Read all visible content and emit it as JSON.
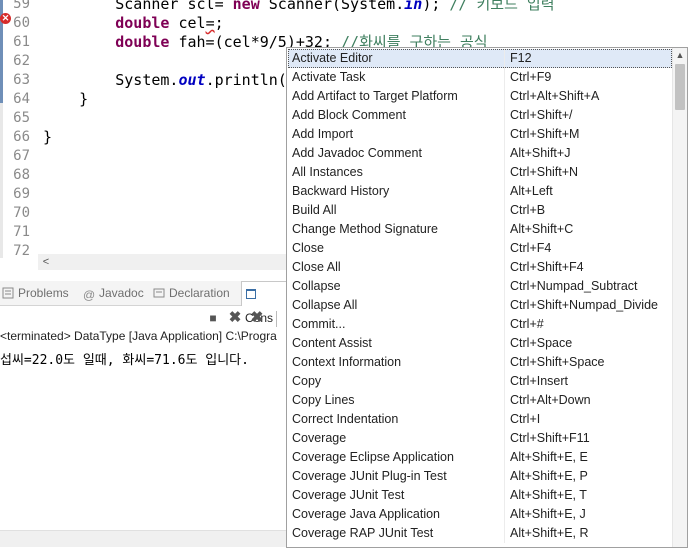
{
  "editor": {
    "line_numbers": [
      "59",
      "60",
      "61",
      "62",
      "63",
      "64",
      "65",
      "66",
      "67",
      "68",
      "69",
      "70",
      "71",
      "72"
    ],
    "lines": [
      {
        "indent": "        ",
        "parts": [
          {
            "t": "Scanner scl= ",
            "c": ""
          },
          {
            "t": "new",
            "c": "kw"
          },
          {
            "t": " Scanner(System.",
            "c": ""
          },
          {
            "t": "in",
            "c": "fld"
          },
          {
            "t": "); ",
            "c": ""
          },
          {
            "t": "// 키보드 입력",
            "c": "cmt"
          }
        ]
      },
      {
        "indent": "        ",
        "parts": [
          {
            "t": "double",
            "c": "kw"
          },
          {
            "t": " cel",
            "c": ""
          },
          {
            "t": "=",
            "c": "squiggle"
          },
          {
            "t": ";",
            "c": ""
          }
        ]
      },
      {
        "indent": "        ",
        "parts": [
          {
            "t": "double",
            "c": "kw"
          },
          {
            "t": " fah=(cel*9/5)+32; ",
            "c": ""
          },
          {
            "t": "//화씨를 구하는 공식",
            "c": "cmt"
          }
        ]
      },
      {
        "indent": "",
        "parts": []
      },
      {
        "indent": "        ",
        "parts": [
          {
            "t": "System.",
            "c": ""
          },
          {
            "t": "out",
            "c": "fld"
          },
          {
            "t": ".println(",
            "c": ""
          }
        ]
      },
      {
        "indent": "    ",
        "parts": [
          {
            "t": "}",
            "c": ""
          }
        ]
      },
      {
        "indent": "",
        "parts": []
      },
      {
        "indent": "",
        "parts": [
          {
            "t": "}",
            "c": ""
          }
        ]
      },
      {
        "indent": "",
        "parts": []
      },
      {
        "indent": "",
        "parts": []
      },
      {
        "indent": "",
        "parts": []
      },
      {
        "indent": "",
        "parts": []
      },
      {
        "indent": "",
        "parts": []
      },
      {
        "indent": "",
        "parts": []
      }
    ],
    "error_line": "60"
  },
  "views": {
    "tabs": [
      {
        "label": "Problems",
        "icon": "problems-icon"
      },
      {
        "label": "Javadoc",
        "icon": "at-icon"
      },
      {
        "label": "Declaration",
        "icon": "declaration-icon"
      },
      {
        "label": "Cons",
        "icon": "console-icon",
        "active": true
      }
    ]
  },
  "console": {
    "header": "<terminated> DataType [Java Application] C:\\Progra",
    "output": "섭씨=22.0도 일때, 화씨=71.6도 입니다."
  },
  "popup": {
    "items": [
      {
        "command": "Activate Editor",
        "key": "F12",
        "selected": true
      },
      {
        "command": "Activate Task",
        "key": "Ctrl+F9"
      },
      {
        "command": "Add Artifact to Target Platform",
        "key": "Ctrl+Alt+Shift+A"
      },
      {
        "command": "Add Block Comment",
        "key": "Ctrl+Shift+/"
      },
      {
        "command": "Add Import",
        "key": "Ctrl+Shift+M"
      },
      {
        "command": "Add Javadoc Comment",
        "key": "Alt+Shift+J"
      },
      {
        "command": "All Instances",
        "key": "Ctrl+Shift+N"
      },
      {
        "command": "Backward History",
        "key": "Alt+Left"
      },
      {
        "command": "Build All",
        "key": "Ctrl+B"
      },
      {
        "command": "Change Method Signature",
        "key": "Alt+Shift+C"
      },
      {
        "command": "Close",
        "key": "Ctrl+F4"
      },
      {
        "command": "Close All",
        "key": "Ctrl+Shift+F4"
      },
      {
        "command": "Collapse",
        "key": "Ctrl+Numpad_Subtract"
      },
      {
        "command": "Collapse All",
        "key": "Ctrl+Shift+Numpad_Divide"
      },
      {
        "command": "Commit...",
        "key": "Ctrl+#"
      },
      {
        "command": "Content Assist",
        "key": "Ctrl+Space"
      },
      {
        "command": "Context Information",
        "key": "Ctrl+Shift+Space"
      },
      {
        "command": "Copy",
        "key": "Ctrl+Insert"
      },
      {
        "command": "Copy Lines",
        "key": "Ctrl+Alt+Down"
      },
      {
        "command": "Correct Indentation",
        "key": "Ctrl+I"
      },
      {
        "command": "Coverage",
        "key": "Ctrl+Shift+F11"
      },
      {
        "command": "Coverage Eclipse Application",
        "key": "Alt+Shift+E, E"
      },
      {
        "command": "Coverage JUnit Plug-in Test",
        "key": "Alt+Shift+E, P"
      },
      {
        "command": "Coverage JUnit Test",
        "key": "Alt+Shift+E, T"
      },
      {
        "command": "Coverage Java Application",
        "key": "Alt+Shift+E, J"
      },
      {
        "command": "Coverage RAP JUnit Test",
        "key": "Alt+Shift+E, R"
      }
    ]
  }
}
